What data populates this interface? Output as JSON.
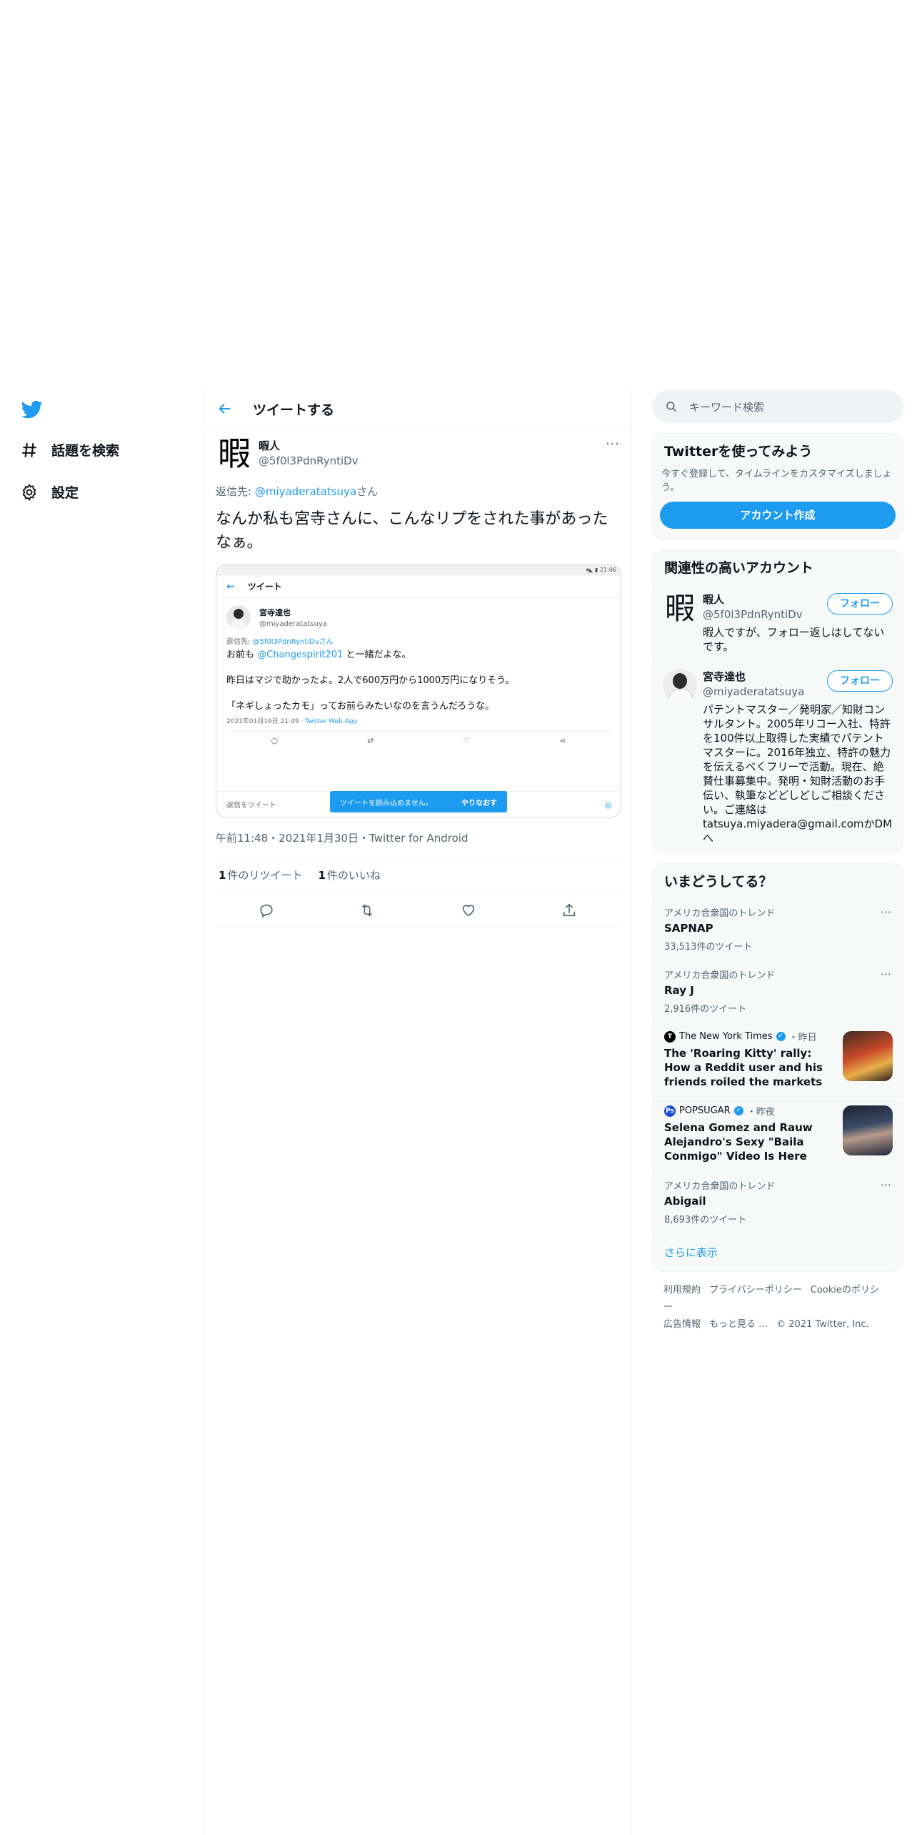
{
  "nav": {
    "items": [
      {
        "label": "話題を検索",
        "icon": "hashtag-icon"
      },
      {
        "label": "設定",
        "icon": "gear-icon"
      }
    ]
  },
  "header": {
    "title": "ツイートする"
  },
  "tweet": {
    "author_name": "暇人",
    "author_handle": "@5f0l3PdnRyntiDv",
    "avatar_char": "暇",
    "more": "···",
    "reply_prefix": "返信先: ",
    "reply_handle": "@miyaderatatsuya",
    "reply_suffix": "さん",
    "text": "なんか私も宮寺さんに、こんなリプをされた事があったなぁ。",
    "meta": "午前11:48・2021年1月30日・Twitter for Android",
    "retweets_count": "1",
    "retweets_label": "件のリツイート",
    "likes_count": "1",
    "likes_label": "件のいいね"
  },
  "embedded": {
    "statusbar": "▾◣ ▮ 21:06",
    "header_title": "ツイート",
    "author_name": "宮寺達也",
    "author_handle": "@miyaderatatsuya",
    "reply_prefix": "返信先: ",
    "reply_handle": "@5f0l3PdnRyntiDv",
    "reply_suffix": "さん",
    "line1_pre": "お前も ",
    "line1_link": "@Changespirit201",
    "line1_post": " と一緒だよな。",
    "line2": "昨日はマジで助かったよ。2人で600万円から1000万円になりそう。",
    "line3": "「ネギしょったカモ」ってお前らみたいなのを言うんだろうな。",
    "meta_time": "2021年01月16日 21:49 · ",
    "meta_client": "Twitter Web App",
    "reply_placeholder": "返信をツイート",
    "toast_text": "ツイートを読み込めません。",
    "toast_action": "やりなおす"
  },
  "search": {
    "placeholder": "キーワード検索"
  },
  "signup": {
    "title": "Twitterを使ってみよう",
    "subtitle": "今すぐ登録して、タイムラインをカスタマイズしましょう。",
    "button": "アカウント作成"
  },
  "relevant": {
    "title": "関連性の高いアカウント",
    "accounts": [
      {
        "name": "暇人",
        "handle": "@5f0l3PdnRyntiDv",
        "bio": "暇人ですが、フォロー返しはしてないです。",
        "follow": "フォロー"
      },
      {
        "name": "宮寺達也",
        "handle": "@miyaderatatsuya",
        "bio": "パテントマスター／発明家／知財コンサルタント。2005年リコー入社、特許を100件以上取得した実績でパテントマスターに。2016年独立、特許の魅力を伝えるべくフリーで活動。現在、絶賛仕事募集中。発明・知財活動のお手伝い、執筆などどしどしご相談ください。ご連絡は tatsuya.miyadera@gmail.comかDMへ",
        "follow": "フォロー"
      }
    ]
  },
  "trends": {
    "title": "いまどうしてる？",
    "t1": {
      "context": "アメリカ合衆国のトレンド",
      "name": "SAPNAP",
      "count": "33,513件のツイート"
    },
    "t2": {
      "context": "アメリカ合衆国のトレンド",
      "name": "Ray J",
      "count": "2,916件のツイート"
    },
    "n1": {
      "source": "The New York Times",
      "when": "・昨日",
      "headline": "The 'Roaring Kitty' rally: How a Reddit user and his friends roiled the markets"
    },
    "n2": {
      "source": "POPSUGAR",
      "when": "・昨夜",
      "headline": "Selena Gomez and Rauw Alejandro's Sexy \"Baila Conmigo\" Video Is Here"
    },
    "t3": {
      "context": "アメリカ合衆国のトレンド",
      "name": "Abigail",
      "count": "8,693件のツイート"
    },
    "show_more": "さらに表示"
  },
  "footer": {
    "links": [
      "利用規約",
      "プライバシーポリシー",
      "Cookieのポリシー",
      "広告情報",
      "もっと見る …",
      "© 2021 Twitter, Inc."
    ]
  },
  "colors": {
    "accent": "#1d9bf0",
    "text": "#0f1419",
    "muted": "#536471"
  }
}
